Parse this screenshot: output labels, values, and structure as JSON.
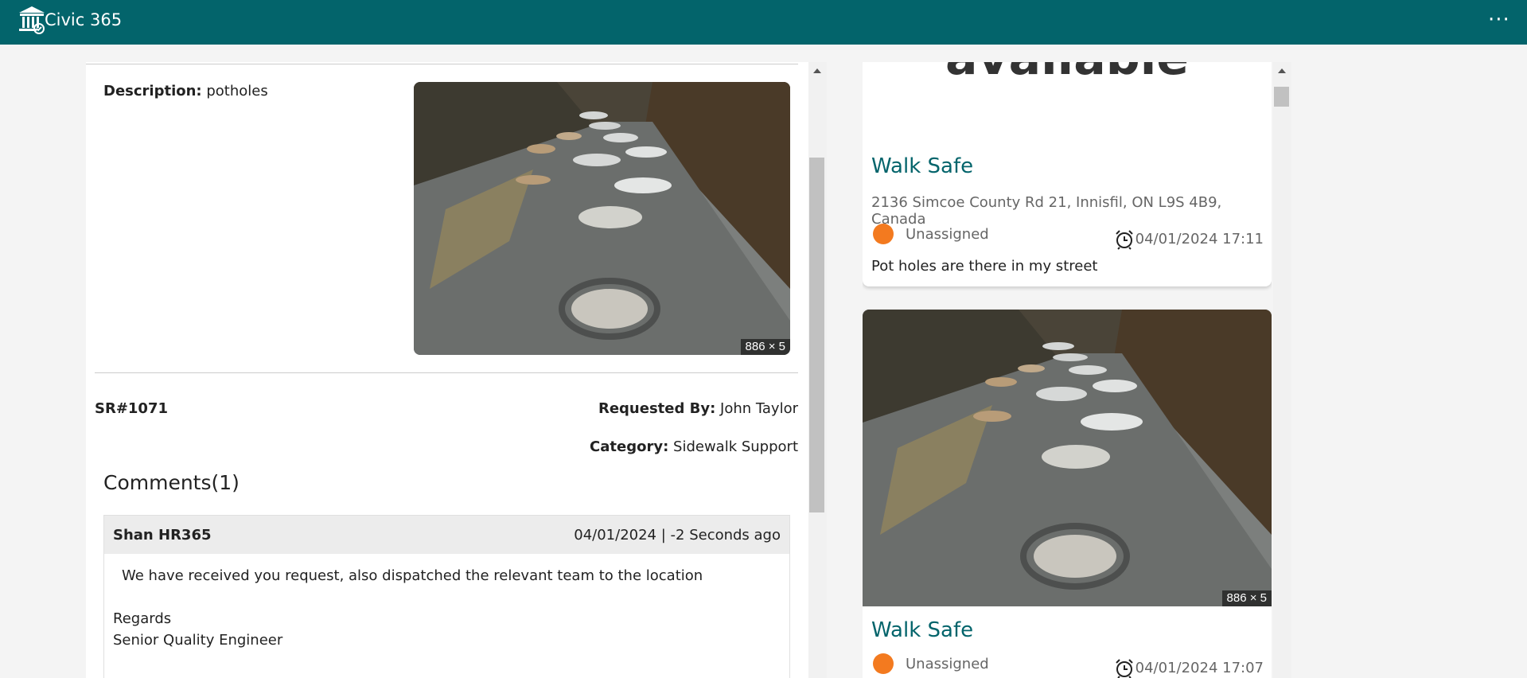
{
  "app": {
    "title": "Civic 365",
    "logo_icon": "bank-building-icon",
    "more_icon": "more-dots-icon"
  },
  "detail": {
    "description_label": "Description:",
    "description_value": "potholes",
    "photo_dimension": "886 × 5",
    "sr_number": "SR#1071",
    "requested_by_label": "Requested By:",
    "requested_by_value": "John Taylor",
    "category_label": "Category:",
    "category_value": "Sidewalk Support",
    "comments_heading": "Comments(1)",
    "comment": {
      "author": "Shan HR365",
      "timestamp": "04/01/2024 | -2 Seconds ago",
      "message": "We have received you request, also dispatched the relevant team to the location",
      "signoff_1": "Regards",
      "signoff_2": "Senior Quality Engineer"
    }
  },
  "feed": {
    "card1": {
      "image_text": "available",
      "title": "Walk Safe",
      "address": "2136 Simcoe County Rd 21, Innisfil, ON L9S 4B9, Canada",
      "status": "Unassigned",
      "status_color": "#f37a1f",
      "datetime": "04/01/2024 17:11",
      "description": "Pot holes are there in my street"
    },
    "card2": {
      "photo_dimension": "886 × 5",
      "title": "Walk Safe",
      "status": "Unassigned",
      "status_color": "#f37a1f",
      "datetime": "04/01/2024 17:07"
    }
  },
  "colors": {
    "header": "#03646b",
    "accent": "#03646b",
    "status_unassigned": "#f37a1f"
  }
}
